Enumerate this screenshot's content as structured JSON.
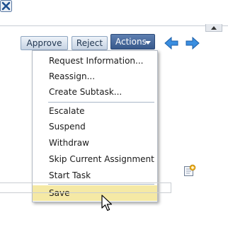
{
  "toolbar": {
    "approve_label": "Approve",
    "reject_label": "Reject",
    "actions_label": "Actions"
  },
  "menu": {
    "items": [
      "Request Information...",
      "Reassign...",
      "Create Subtask...",
      "Escalate",
      "Suspend",
      "Withdraw",
      "Skip Current Assignment",
      "Start Task",
      "Save"
    ],
    "selected": "Save"
  },
  "icons": {
    "prev": "arrow-left-icon",
    "next": "arrow-right-icon",
    "close": "close-icon",
    "note": "add-note-icon",
    "collapse": "collapse-up-icon",
    "cursor": "mouse-pointer-icon"
  },
  "colors": {
    "actions_button": "#4a6a9c",
    "selected_item": "#f5e9a5",
    "nav_arrows": "#2f7fd1"
  }
}
